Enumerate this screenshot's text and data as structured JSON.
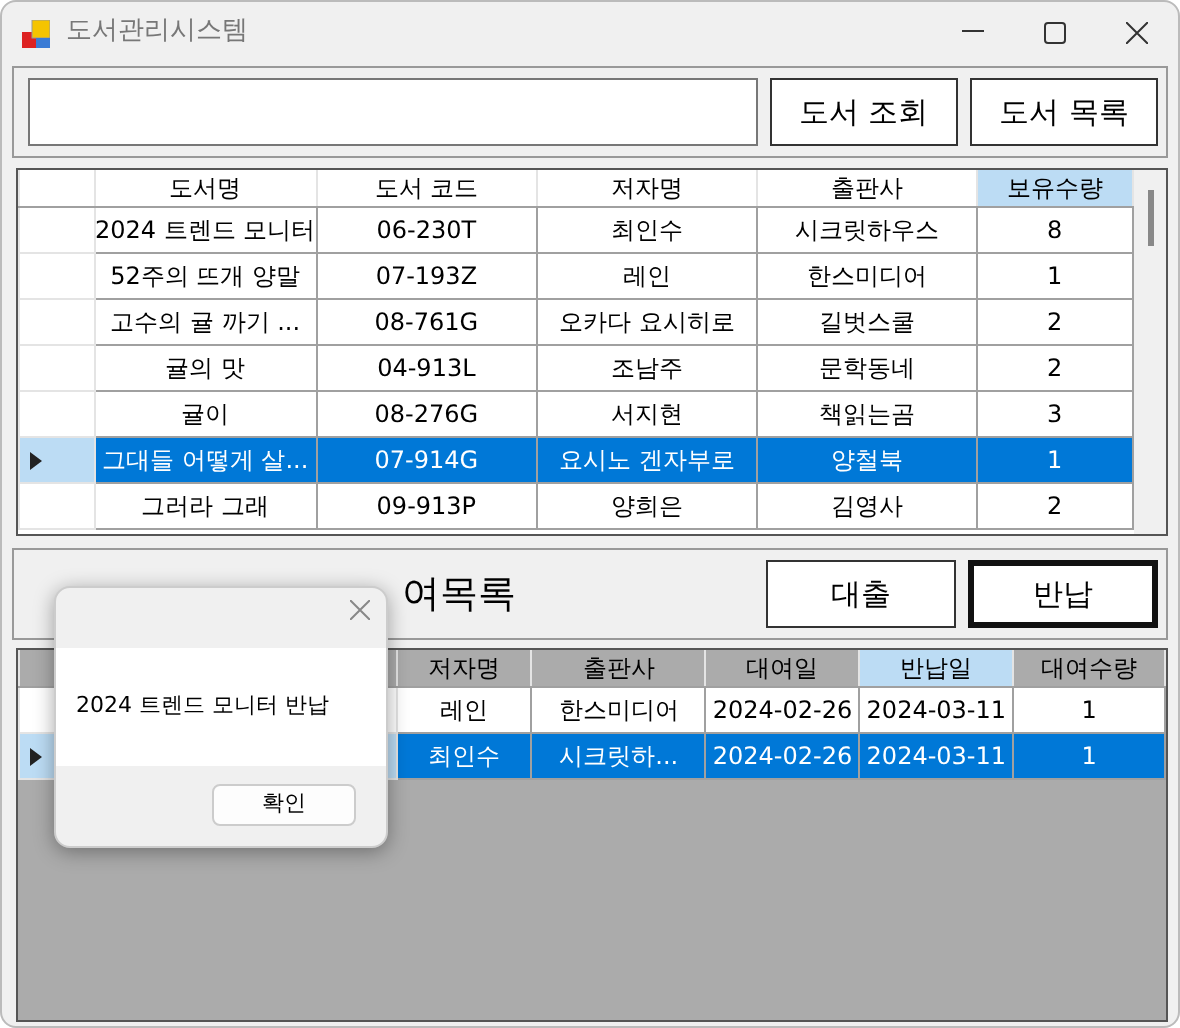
{
  "window": {
    "title": "도서관리시스템"
  },
  "search": {
    "buttons": [
      "도서 조회",
      "도서 목록"
    ]
  },
  "books": {
    "columns": [
      {
        "label": "도서명",
        "sorted": false
      },
      {
        "label": "도서 코드",
        "sorted": false
      },
      {
        "label": "저자명",
        "sorted": false
      },
      {
        "label": "출판사",
        "sorted": false
      },
      {
        "label": "보유수량",
        "sorted": true
      }
    ],
    "rows": [
      {
        "cells": [
          "2024 트렌드 모니터",
          "06-230T",
          "최인수",
          "시크릿하우스",
          "8"
        ],
        "selected": false
      },
      {
        "cells": [
          "52주의 뜨개 양말",
          "07-193Z",
          "레인",
          "한스미디어",
          "1"
        ],
        "selected": false
      },
      {
        "cells": [
          "고수의 귤 까기 ...",
          "08-761G",
          "오카다 요시히로",
          "길벗스쿨",
          "2"
        ],
        "selected": false
      },
      {
        "cells": [
          "귤의 맛",
          "04-913L",
          "조남주",
          "문학동네",
          "2"
        ],
        "selected": false
      },
      {
        "cells": [
          "귤이",
          "08-276G",
          "서지현",
          "책읽는곰",
          "3"
        ],
        "selected": false
      },
      {
        "cells": [
          "그대들 어떻게 살...",
          "07-914G",
          "요시노 겐자부로",
          "양철북",
          "1"
        ],
        "selected": true
      },
      {
        "cells": [
          "그러라 그래",
          "09-913P",
          "양희은",
          "김영사",
          "2"
        ],
        "selected": false
      }
    ]
  },
  "loan_panel": {
    "label": "여목록",
    "buttons": [
      {
        "label": "대출",
        "focused": false
      },
      {
        "label": "반납",
        "focused": true
      }
    ]
  },
  "loans": {
    "columns": [
      {
        "label": "저자명",
        "sorted": false
      },
      {
        "label": "출판사",
        "sorted": false
      },
      {
        "label": "대여일",
        "sorted": false
      },
      {
        "label": "반납일",
        "sorted": true
      },
      {
        "label": "대여수량",
        "sorted": false
      }
    ],
    "rows": [
      {
        "cells": [
          "레인",
          "한스미디어",
          "2024-02-26",
          "2024-03-11",
          "1"
        ],
        "selected": false
      },
      {
        "cells": [
          "최인수",
          "시크릿하...",
          "2024-02-26",
          "2024-03-11",
          "1"
        ],
        "selected": true
      }
    ]
  },
  "dialog": {
    "message": "2024 트렌드 모니터 반납",
    "button": "확인"
  }
}
